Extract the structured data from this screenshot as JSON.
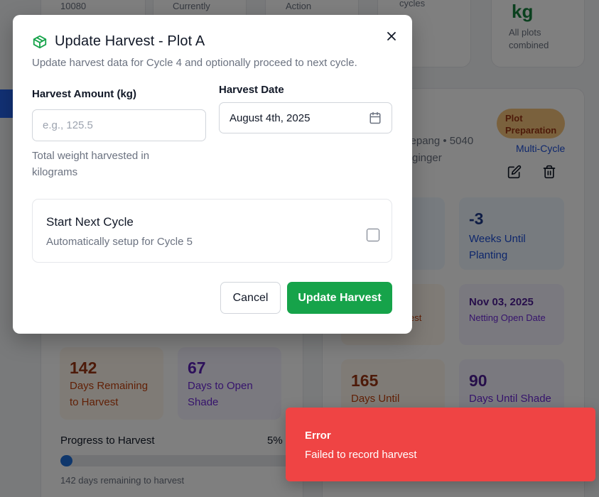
{
  "background": {
    "top_stats": [
      {
        "value": "10080",
        "label": ""
      },
      {
        "value": "",
        "label": "Currently"
      },
      {
        "value": "",
        "label": "Action"
      },
      {
        "value": "",
        "label": "cycles"
      },
      {
        "value": "kg",
        "label": "All plots combined"
      }
    ],
    "plot_card": {
      "status_pill": "Plot Preparation",
      "location_text": "i Sepang • 5040",
      "crop_text": "ginger",
      "multi_cycle": "Multi-Cycle",
      "weeks_value": "-3",
      "weeks_label": "Weeks Until Planting",
      "partial_label": "est",
      "netting_date": "Nov 03, 2025",
      "netting_label": "Netting Open Date",
      "days_until_value": "165",
      "days_until_label": "Days Until",
      "shade_value": "90",
      "shade_label": "Days Until Shade"
    },
    "left_card": {
      "remaining_value": "142",
      "remaining_label": "Days Remaining to Harvest",
      "open_shade_value": "67",
      "open_shade_label": "Days to Open Shade",
      "progress_label": "Progress to Harvest",
      "progress_pct_text": "5%",
      "progress_value": 5,
      "progress_note": "142 days remaining to harvest"
    }
  },
  "modal": {
    "title": "Update Harvest - Plot A",
    "subtitle": "Update harvest data for Cycle 4 and optionally proceed to next cycle.",
    "amount_label": "Harvest Amount (kg)",
    "amount_placeholder": "e.g., 125.5",
    "amount_value": "",
    "amount_helper": "Total weight harvested in kilograms",
    "date_label": "Harvest Date",
    "date_value": "August 4th, 2025",
    "next_cycle_title": "Start Next Cycle",
    "next_cycle_sub": "Automatically setup for Cycle 5",
    "next_cycle_checked": false,
    "cancel_label": "Cancel",
    "update_label": "Update Harvest",
    "icons": {
      "title": "package-icon",
      "close": "close-icon",
      "date": "calendar-icon"
    }
  },
  "toast": {
    "title": "Error",
    "message": "Failed to record harvest"
  },
  "colors": {
    "primary_green": "#16a34a",
    "error_red": "#ef4444",
    "progress_blue": "#1e6fd9",
    "pill_orange": "#f5c27a"
  }
}
